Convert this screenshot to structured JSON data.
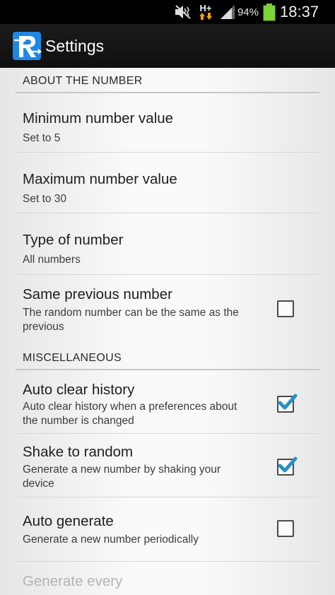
{
  "status_bar": {
    "network_type": "H+",
    "battery_percent": "94%",
    "battery_level": 0.94,
    "clock": "18:37",
    "icons": [
      "mute-icon",
      "network-arrows-icon",
      "signal-icon",
      "battery-icon"
    ]
  },
  "action_bar": {
    "title": "Settings",
    "logo_letter": "R",
    "accent_color": "#1e88e5"
  },
  "sections": {
    "about": {
      "header": "ABOUT THE NUMBER",
      "min": {
        "title": "Minimum number value",
        "summary": "Set to 5"
      },
      "max": {
        "title": "Maximum number value",
        "summary": "Set to 30"
      },
      "type": {
        "title": "Type of number",
        "summary": "All numbers"
      },
      "same_prev": {
        "title": "Same previous number",
        "summary": "The random number can be the same as the previous",
        "checked": false
      }
    },
    "misc": {
      "header": "MISCELLANEOUS",
      "auto_clear": {
        "title": "Auto clear history",
        "summary": "Auto clear history when a preferences about the number is changed",
        "checked": true
      },
      "shake": {
        "title": "Shake to random",
        "summary": "Generate a new number by shaking your device",
        "checked": true
      },
      "auto_gen": {
        "title": "Auto generate",
        "summary": "Generate a new number periodically",
        "checked": false
      },
      "generate_every": {
        "title": "Generate every",
        "enabled": false
      }
    }
  },
  "colors": {
    "check_color": "#2a8fc9",
    "disabled_text": "#b4b4b4"
  }
}
